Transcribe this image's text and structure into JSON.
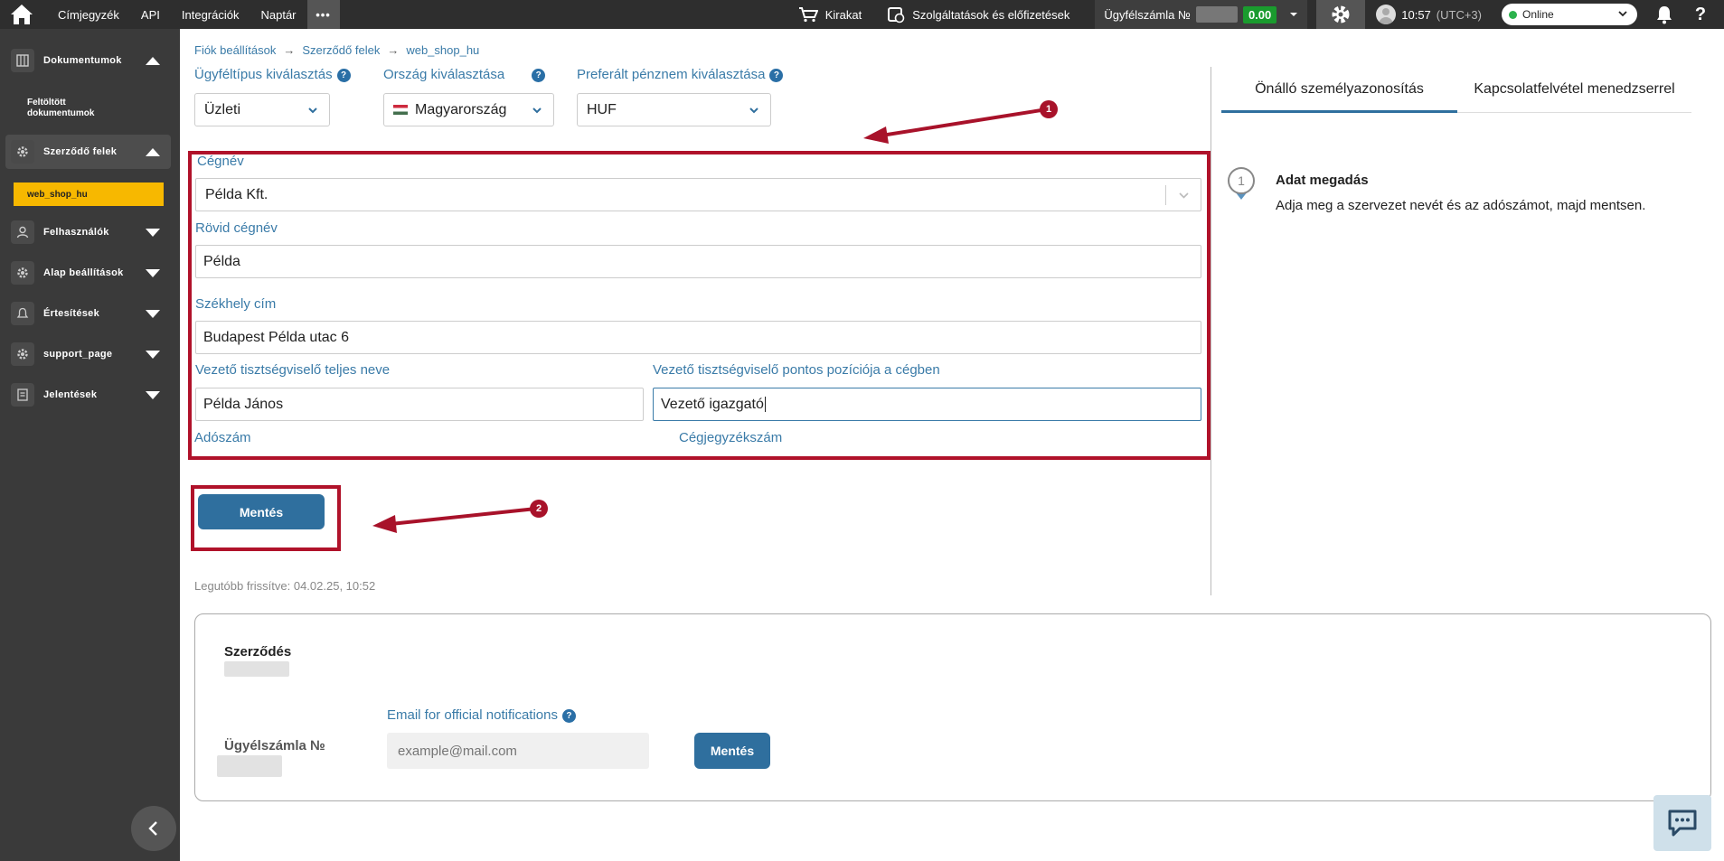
{
  "topbar": {
    "nav": [
      "Címjegyzék",
      "API",
      "Integrációk",
      "Naptár"
    ],
    "more": "•••",
    "shop_label": "Kirakat",
    "services_label": "Szolgáltatások és előfizetések",
    "account_label": "Ügyfélszámla №",
    "balance": "0.00",
    "time": "10:57",
    "timezone": "(UTC+3)",
    "status": "Online",
    "help": "?"
  },
  "sidebar": {
    "documents": "Dokumentumok",
    "uploaded_docs": "Feltöltött dokumentumok",
    "contracting_parties": "Szerződő felek",
    "active_sub": "web_shop_hu",
    "users": "Felhasználók",
    "basic_settings": "Alap beállítások",
    "notifications": "Értesítések",
    "support": "support_page",
    "reports": "Jelentések"
  },
  "breadcrumb": [
    "Fiók beállítások",
    "Szerződő felek",
    "web_shop_hu"
  ],
  "form": {
    "client_type_label": "Ügyféltípus kiválasztás",
    "client_type_value": "Üzleti",
    "country_label": "Ország kiválasztása",
    "country_value": "Magyarország",
    "currency_label": "Preferált pénznem kiválasztása",
    "currency_value": "HUF",
    "company_name_label": "Cégnév",
    "company_name_value": "Példa Kft.",
    "short_name_label": "Rövid cégnév",
    "short_name_value": "Példa",
    "address_label": "Székhely cím",
    "address_value": "Budapest Példa utac 6",
    "exec_name_label": "Vezető tisztségviselő teljes neve",
    "exec_name_value": "Példa János",
    "exec_position_label": "Vezető tisztségviselő pontos pozíciója a cégben",
    "exec_position_value": "Vezető igazgató",
    "tax_number_label": "Adószám",
    "registry_number_label": "Cégjegyzékszám",
    "save_label": "Mentés",
    "last_updated": "Legutóbb frissítve: 04.02.25, 10:52"
  },
  "annotations": {
    "badge1": "1",
    "badge2": "2"
  },
  "right_panel": {
    "tab_self": "Önálló személyazonosítás",
    "tab_manager": "Kapcsolatfelvétel menedzserrel",
    "step_number": "1",
    "step_title": "Adat megadás",
    "step_desc": "Adja meg a szervezet nevét és az adószámot, majd mentsen."
  },
  "contract": {
    "title": "Szerződés",
    "account_label": "Ügyélszámla №",
    "email_label": "Email for official notifications",
    "email_placeholder": "example@mail.com",
    "save_label": "Mentés"
  },
  "colors": {
    "accent": "#2f6f9e",
    "annotation_red": "#b0122a",
    "highlight": "#f7b800",
    "balance_green": "#1a9b2e"
  }
}
